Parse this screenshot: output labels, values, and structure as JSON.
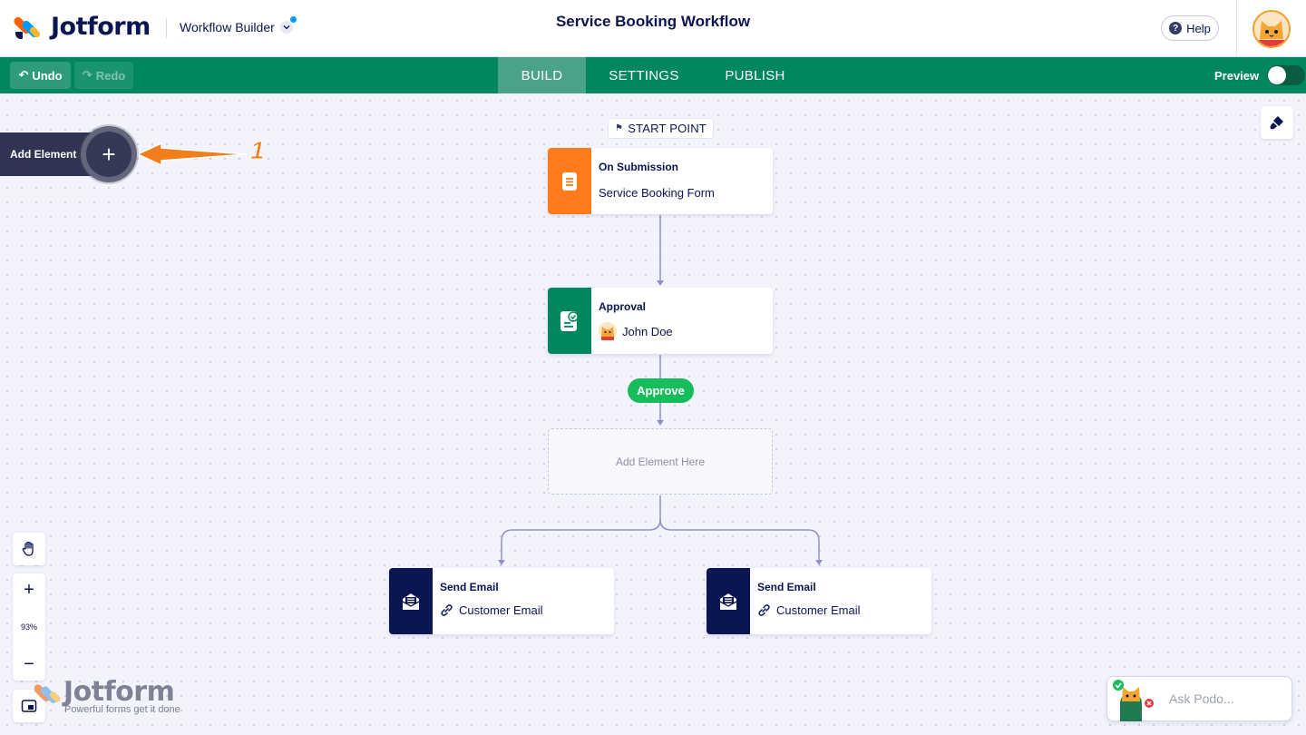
{
  "header": {
    "brand": "Jotform",
    "product": "Workflow Builder",
    "title": "Service Booking Workflow",
    "help_label": "Help"
  },
  "toolbar": {
    "undo_label": "Undo",
    "redo_label": "Redo",
    "tabs": [
      {
        "label": "BUILD",
        "active": true
      },
      {
        "label": "SETTINGS",
        "active": false
      },
      {
        "label": "PUBLISH",
        "active": false
      }
    ],
    "preview_label": "Preview",
    "preview_on": false
  },
  "canvas": {
    "add_element_label": "Add Element",
    "annotation_number": "1",
    "start_point_label": "START POINT",
    "nodes": [
      {
        "title": "On Submission",
        "subtitle": "Service Booking Form",
        "color": "#ff7b1c",
        "icon": "form-icon"
      },
      {
        "title": "Approval",
        "subtitle": "John Doe",
        "color": "#01875f",
        "icon": "approval-icon"
      },
      {
        "title": "Send Email",
        "subtitle": "Customer Email",
        "color": "#0a1551",
        "icon": "email-icon"
      },
      {
        "title": "Send Email",
        "subtitle": "Customer Email",
        "color": "#0a1551",
        "icon": "email-icon"
      }
    ],
    "approve_label": "Approve",
    "placeholder_label": "Add Element Here",
    "zoom_level": "93%"
  },
  "watermark": {
    "brand": "Jotform",
    "tagline": "Powerful forms get it done"
  },
  "assistant": {
    "placeholder": "Ask Podo..."
  },
  "colors": {
    "toolbar_green": "#01875f",
    "active_tab": "#4aa389",
    "navy": "#0a1551",
    "approve_green": "#18bd5b",
    "accent_orange": "#ff7b1c"
  }
}
